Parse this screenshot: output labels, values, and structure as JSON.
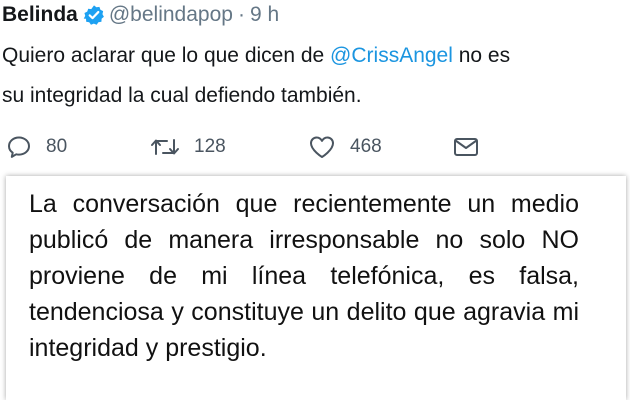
{
  "tweet": {
    "author_name": "Belinda",
    "handle": "@belindapop",
    "separator": "·",
    "time": "9 h",
    "text_line1_before": "Quiero aclarar que lo que dicen de ",
    "mention": "@CrissAngel",
    "text_line1_after": " no es",
    "text_line2": "su integridad la cual defiendo también.",
    "verified_icon": "verified-badge-icon",
    "verified_color": "#1da1f2"
  },
  "actions": {
    "reply_count": "80",
    "retweet_count": "128",
    "like_count": "468"
  },
  "statement": {
    "text": "La conversación que recientemente un medio publicó de manera irresponsable no solo NO proviene de mi línea telefónica, es falsa, tendenciosa y constituye un delito que agravia mi integridad y prestigio."
  }
}
